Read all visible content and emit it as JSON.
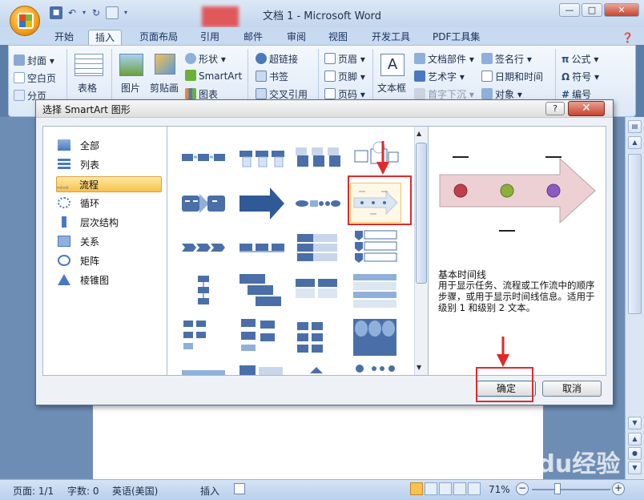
{
  "window": {
    "title": "文档 1 - Microsoft Word",
    "minimize_glyph": "—",
    "maximize_glyph": "□",
    "close_glyph": "✕"
  },
  "ribbon_tabs": [
    "开始",
    "插入",
    "页面布局",
    "引用",
    "邮件",
    "审阅",
    "视图",
    "开发工具",
    "PDF工具集"
  ],
  "active_tab": "插入",
  "ribbon": {
    "cover": "封面",
    "blank_page": "空白页",
    "page_break": "分页",
    "table": "表格",
    "picture": "图片",
    "clipart": "剪贴画",
    "shapes": "形状",
    "smartart": "SmartArt",
    "chart": "图表",
    "hyperlink": "超链接",
    "bookmark": "书签",
    "crossref": "交叉引用",
    "header": "页眉",
    "footer": "页脚",
    "pagenum": "页码",
    "textbox": "文本框",
    "quickparts": "文档部件",
    "wordart": "艺术字",
    "dropcap": "首字下沉",
    "signature": "签名行",
    "datetime": "日期和时间",
    "object": "对象",
    "equation": "公式",
    "symbol": "符号",
    "numbering": "编号"
  },
  "dialog": {
    "title": "选择 SmartArt 图形",
    "help": "?",
    "close": "✕",
    "categories": [
      "全部",
      "列表",
      "流程",
      "循环",
      "层次结构",
      "关系",
      "矩阵",
      "棱锥图"
    ],
    "selected_category": "流程",
    "preview_name": "基本时间线",
    "preview_desc": "用于显示任务、流程或工作流中的顺序步骤，或用于显示时间线信息。适用于级别 1 和级别 2 文本。",
    "ok": "确定",
    "cancel": "取消"
  },
  "status": {
    "page": "页面: 1/1",
    "words": "字数: 0",
    "language": "英语(美国)",
    "mode": "插入",
    "zoom": "71%"
  },
  "watermark": "Baidu经验",
  "colors": {
    "accent_red": "#e02a2a",
    "selection": "#f8c24b",
    "title_bar": "#c3d6ee"
  }
}
